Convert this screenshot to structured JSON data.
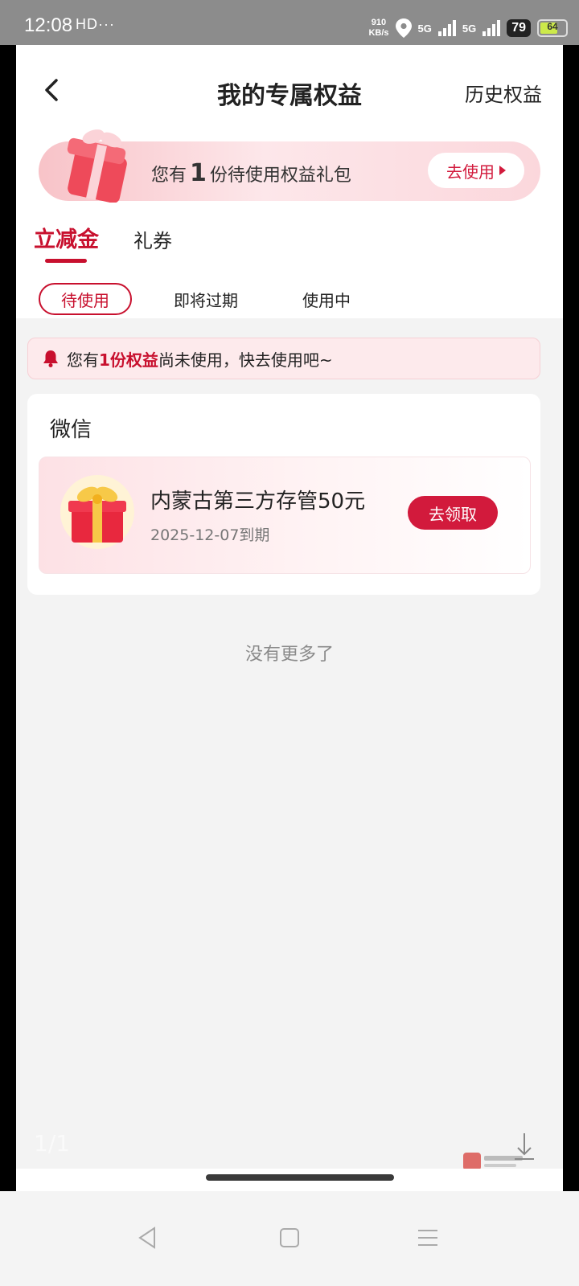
{
  "status_bar": {
    "time": "12:08",
    "left_extra": "HD···",
    "net_speed_value": "910",
    "net_speed_unit": "KB/s",
    "sim1": "5G",
    "sim2": "5G",
    "badge": "79",
    "battery_level": "64"
  },
  "header": {
    "title": "我的专属权益",
    "history_label": "历史权益"
  },
  "banner": {
    "prefix": "您有",
    "count": "1",
    "suffix": "份待使用权益礼包",
    "button_label": "去使用"
  },
  "tabs": {
    "active": "立减金",
    "inactive": "礼券"
  },
  "filters": {
    "items": [
      "待使用",
      "即将过期",
      "使用中"
    ],
    "selected": "待使用"
  },
  "notice": {
    "prefix": "您有",
    "highlight": "1份权益",
    "suffix": "尚未使用，快去使用吧~"
  },
  "section": {
    "title": "微信",
    "coupons": [
      {
        "name": "内蒙古第三方存管50元",
        "expire": "2025-12-07到期",
        "button_label": "去领取"
      }
    ]
  },
  "footer": {
    "no_more": "没有更多了",
    "page_indicator": "1/1"
  },
  "colors": {
    "accent": "#c8102e",
    "page_bg": "#f3f3f3"
  }
}
